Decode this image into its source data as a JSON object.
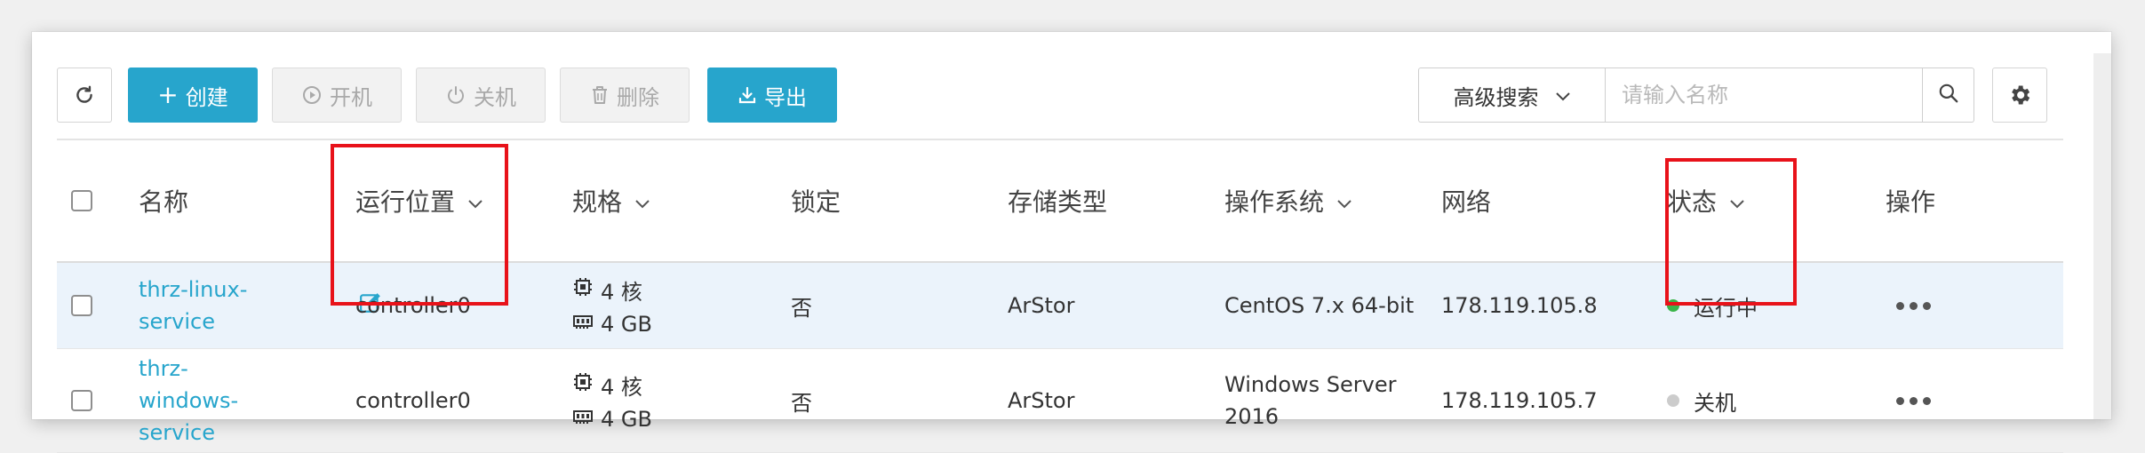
{
  "toolbar": {
    "refresh_icon": "refresh-icon",
    "create_label": "创建",
    "start_label": "开机",
    "shutdown_label": "关机",
    "delete_label": "删除",
    "export_label": "导出",
    "advanced_search_label": "高级搜索",
    "search_placeholder": "请输入名称",
    "search_value": ""
  },
  "table": {
    "columns": {
      "name": "名称",
      "location": "运行位置",
      "spec": "规格",
      "lock": "锁定",
      "storage": "存储类型",
      "os": "操作系统",
      "network": "网络",
      "status": "状态",
      "actions": "操作"
    },
    "rows": [
      {
        "name_line1": "thrz-linux-",
        "name_line2": "service",
        "name_line3": "",
        "location": "controller0",
        "cpu": "4 核",
        "memory": "4 GB",
        "lock": "否",
        "storage": "ArStor",
        "os_line1": "CentOS 7.x 64-bit",
        "os_line2": "",
        "network": "178.119.105.8",
        "status": "运行中"
      },
      {
        "name_line1": "thrz-",
        "name_line2": "windows-",
        "name_line3": "service",
        "location": "controller0",
        "cpu": "4 核",
        "memory": "4 GB",
        "lock": "否",
        "storage": "ArStor",
        "os_line1": "Windows Server",
        "os_line2": "2016",
        "network": "178.119.105.7",
        "status": "关机"
      }
    ]
  },
  "colors": {
    "primary": "#27a5cc",
    "row_selected": "#ebf3fb",
    "status_running": "#3bb54a",
    "status_off": "#cccccc",
    "highlight_box": "#e8121a"
  }
}
